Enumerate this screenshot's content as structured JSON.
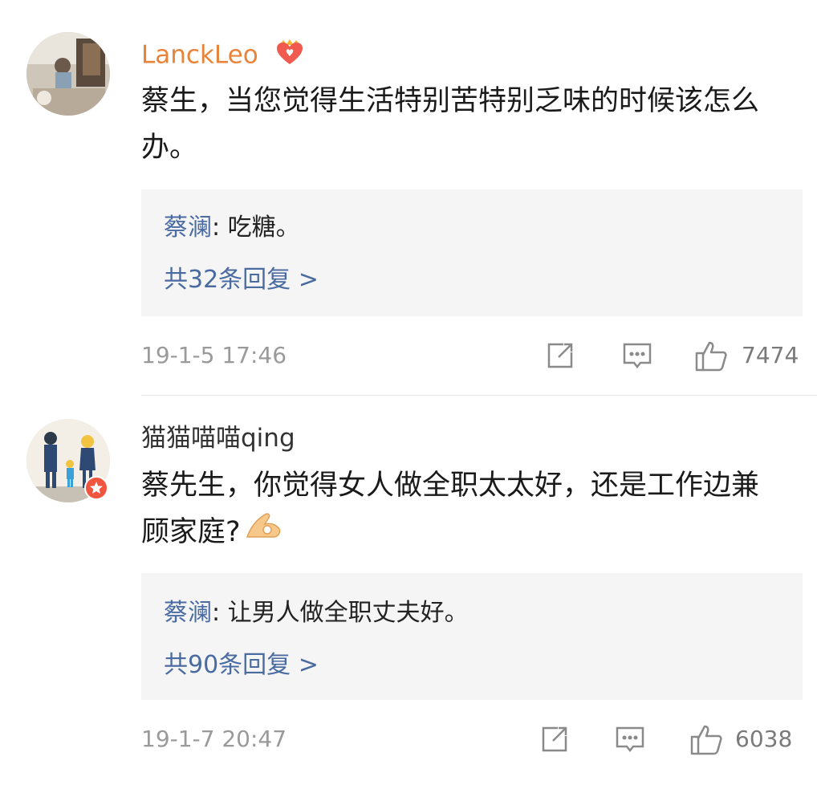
{
  "comments": [
    {
      "username": "LanckLeo",
      "username_color": "#e8833a",
      "badge_icon": "vip-heart-crown-icon",
      "text": "蔡生，当您觉得生活特别苦特别乏味的时候该怎么办。",
      "reply": {
        "author": "蔡澜",
        "separator": ": ",
        "text": "吃糖。"
      },
      "reply_count": "共32条回复 >",
      "time": "19-1-5 17:46",
      "likes": "7474"
    },
    {
      "username": "猫猫喵喵qing",
      "username_color": "#333333",
      "badge_icon": "verified-star-badge-icon",
      "text": "蔡先生，你觉得女人做全职太太好，还是工作边兼顾家庭?",
      "trailing_emoji": "ok-hand-emoji-icon",
      "reply": {
        "author": "蔡澜",
        "separator": ": ",
        "text": "让男人做全职丈夫好。"
      },
      "reply_count": "共90条回复 >",
      "time": "19-1-7 20:47",
      "likes": "6038"
    }
  ]
}
